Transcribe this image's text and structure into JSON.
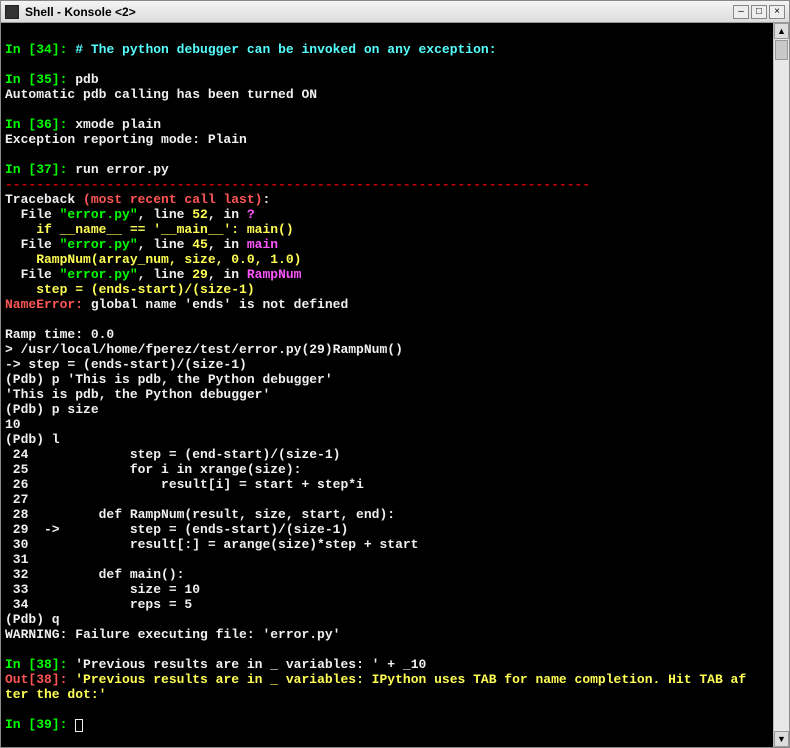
{
  "window": {
    "title": "Shell - Konsole <2>"
  },
  "prompt": {
    "34": {
      "in": "In [34]:",
      "cmd": "# The python debugger can be invoked on any exception:"
    },
    "35": {
      "in": "In [35]:",
      "cmd": "pdb",
      "out": "Automatic pdb calling has been turned ON"
    },
    "36": {
      "in": "In [36]:",
      "cmd": "xmode plain",
      "out": "Exception reporting mode: Plain"
    },
    "37": {
      "in": "In [37]:",
      "cmd": "run error.py"
    },
    "38": {
      "in": "In [38]:",
      "cmd": "'Previous results are in _ variables: ' + _10",
      "outlabel": "Out[38]:",
      "outval": "'Previous results are in _ variables: IPython uses TAB for name completion. Hit TAB af\nter the dot:'"
    },
    "39": {
      "in": "In [39]:"
    }
  },
  "dashes": "---------------------------------------------------------------------------",
  "tb": {
    "header1": "Traceback ",
    "header2": "(most recent call last)",
    "colon": ":",
    "l1a": "  File ",
    "l1b": "\"error.py\"",
    "l1c": ", line ",
    "l1d": "52",
    "l1e": ", in ",
    "l1f": "?",
    "l1src": "    if __name__ == '__main__': main()",
    "l2a": "  File ",
    "l2b": "\"error.py\"",
    "l2c": ", line ",
    "l2d": "45",
    "l2e": ", in ",
    "l2f": "main",
    "l2src": "    RampNum(array_num, size, 0.0, 1.0)",
    "l3a": "  File ",
    "l3b": "\"error.py\"",
    "l3c": ", line ",
    "l3d": "29",
    "l3e": ", in ",
    "l3f": "RampNum",
    "l3src": "    step = (ends-start)/(size-1)",
    "err1": "NameError:",
    "err2": " global name 'ends' is not defined"
  },
  "pdb": {
    "ramp": "Ramp time: 0.0",
    "loc": "> /usr/local/home/fperez/test/error.py(29)RampNum()",
    "arrow": "-> step = (ends-start)/(size-1)",
    "p1": "(Pdb) p 'This is pdb, the Python debugger'",
    "p1r": "'This is pdb, the Python debugger'",
    "p2": "(Pdb) p size",
    "p2r": "10",
    "pl": "(Pdb) l",
    "src24": " 24             step = (end-start)/(size-1)",
    "src25": " 25             for i in xrange(size):",
    "src26": " 26                 result[i] = start + step*i",
    "src27": " 27     ",
    "src28": " 28         def RampNum(result, size, start, end):",
    "src29": " 29  ->         step = (ends-start)/(size-1)",
    "src30": " 30             result[:] = arange(size)*step + start",
    "src31": " 31     ",
    "src32": " 32         def main():",
    "src33": " 33             size = 10",
    "src34": " 34             reps = 5",
    "pq": "(Pdb) q",
    "warn": "WARNING: Failure executing file: 'error.py'"
  }
}
